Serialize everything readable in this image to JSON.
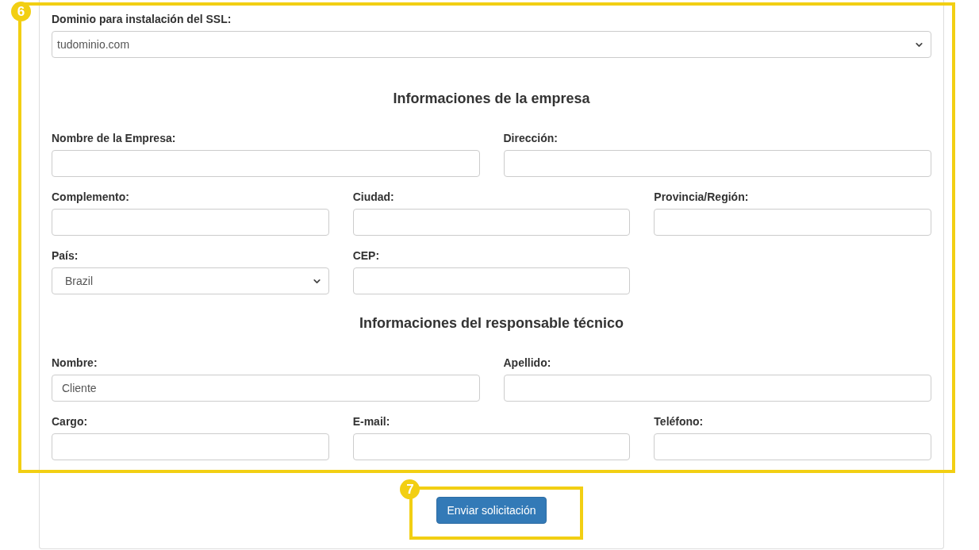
{
  "domain_field": {
    "kind": "select",
    "label": "Dominio para instalación del SSL:",
    "value": "tudominio.com"
  },
  "sections": [
    {
      "title": "Informaciones de la empresa",
      "rows": [
        {
          "kind": "halves",
          "fields": [
            {
              "kind": "text",
              "label": "Nombre de la Empresa:"
            },
            {
              "kind": "text",
              "label": "Dirección:"
            }
          ]
        },
        {
          "kind": "thirds",
          "fields": [
            {
              "kind": "text",
              "label": "Complemento:"
            },
            {
              "kind": "text",
              "label": "Ciudad:"
            },
            {
              "kind": "text",
              "label": "Provincia/Región:"
            }
          ]
        },
        {
          "kind": "thirds",
          "fields": [
            {
              "kind": "select",
              "label": "País:",
              "value": "Brazil"
            },
            {
              "kind": "text",
              "label": "CEP:"
            }
          ]
        }
      ]
    },
    {
      "title": "Informaciones del responsable técnico",
      "rows": [
        {
          "kind": "halves",
          "fields": [
            {
              "kind": "text",
              "label": "Nombre:",
              "value": "Cliente"
            },
            {
              "kind": "text",
              "label": "Apellido:"
            }
          ]
        },
        {
          "kind": "thirds",
          "fields": [
            {
              "kind": "text",
              "label": "Cargo:"
            },
            {
              "kind": "text",
              "label": "E-mail:"
            },
            {
              "kind": "text",
              "label": "Teléfono:"
            }
          ]
        }
      ]
    }
  ],
  "submit_button": {
    "label": "Enviar solicitación"
  },
  "annotations": [
    {
      "number": "6"
    },
    {
      "number": "7"
    }
  ]
}
